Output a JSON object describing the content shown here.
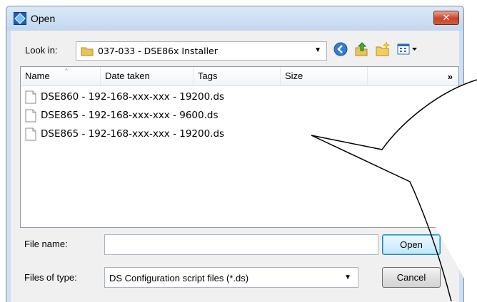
{
  "window": {
    "title": "Open",
    "close_glyph": "✕"
  },
  "lookin": {
    "label": "Look in:",
    "folder": "037-033 - DSE86x Installer"
  },
  "toolbar": {
    "icons": [
      "back-icon",
      "up-folder-icon",
      "new-folder-icon",
      "views-menu-icon"
    ]
  },
  "columns": {
    "name": "Name",
    "date_taken": "Date taken",
    "tags": "Tags",
    "size": "Size",
    "more": "»"
  },
  "files": [
    {
      "name": "DSE860 - 192-168-xxx-xxx - 19200.ds"
    },
    {
      "name": "DSE865 - 192-168-xxx-xxx - 9600.ds"
    },
    {
      "name": "DSE865 - 192-168-xxx-xxx - 19200.ds"
    }
  ],
  "file_name": {
    "label": "File name:",
    "value": ""
  },
  "file_type": {
    "label": "Files of type:",
    "value": "DS Configuration script files (*.ds)"
  },
  "buttons": {
    "open": "Open",
    "cancel": "Cancel"
  },
  "colors": {
    "accent": "#3c7fb1",
    "titlebar": "#cfe0f3",
    "close": "#c5432c"
  }
}
